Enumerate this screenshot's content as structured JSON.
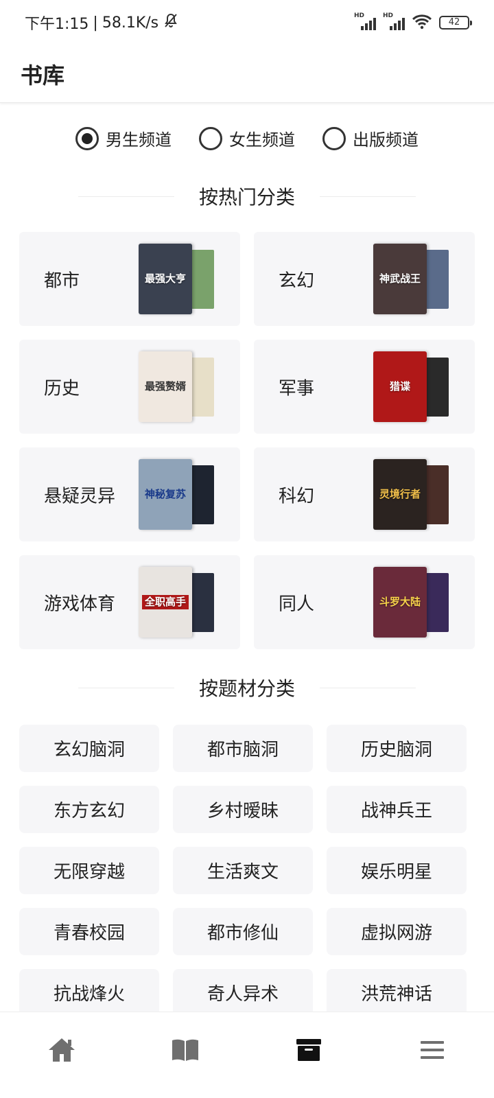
{
  "status_bar": {
    "time": "下午1:15",
    "speed": "58.1K/s",
    "signal_tag": "HD",
    "battery": "42",
    "icons": [
      "mute-bell-icon",
      "signal-icon",
      "wifi-icon",
      "battery-icon"
    ]
  },
  "header": {
    "title": "书库"
  },
  "channels": [
    {
      "label": "男生频道",
      "checked": true
    },
    {
      "label": "女生频道",
      "checked": false
    },
    {
      "label": "出版频道",
      "checked": false
    }
  ],
  "hot_section": {
    "title": "按热门分类",
    "cards": [
      {
        "label": "都市",
        "cover_title": "最强大亨",
        "front_color": "#3a4150",
        "back_color": "#7aa26b"
      },
      {
        "label": "玄幻",
        "cover_title": "神武战王",
        "front_color": "#4a3a3a",
        "back_color": "#5a6b8a"
      },
      {
        "label": "历史",
        "cover_title": "最强赘婿",
        "front_color": "#f0e8e0",
        "back_color": "#e7dfc8"
      },
      {
        "label": "军事",
        "cover_title": "猎谍",
        "front_color": "#b01818",
        "back_color": "#2a2a2a"
      },
      {
        "label": "悬疑灵异",
        "cover_title": "神秘复苏",
        "front_color": "#8fa3b8",
        "back_color": "#1e2430"
      },
      {
        "label": "科幻",
        "cover_title": "灵境行者",
        "front_color": "#2b2320",
        "back_color": "#4a2e28"
      },
      {
        "label": "游戏体育",
        "cover_title": "全职高手",
        "front_color": "#e8e4e0",
        "back_color": "#2a3040"
      },
      {
        "label": "同人",
        "cover_title": "斗罗大陆",
        "front_color": "#6a2a3a",
        "back_color": "#3a2a5a"
      }
    ]
  },
  "subject_section": {
    "title": "按题材分类",
    "chips": [
      "玄幻脑洞",
      "都市脑洞",
      "历史脑洞",
      "东方玄幻",
      "乡村暧昧",
      "战神兵王",
      "无限穿越",
      "生活爽文",
      "娱乐明星",
      "青春校园",
      "都市修仙",
      "虚拟网游",
      "抗战烽火",
      "奇人异术",
      "洪荒神话"
    ]
  },
  "bottom_nav": [
    {
      "icon": "home-icon",
      "active": false
    },
    {
      "icon": "book-open-icon",
      "active": false
    },
    {
      "icon": "archive-box-icon",
      "active": true
    },
    {
      "icon": "menu-icon",
      "active": false
    }
  ],
  "colors": {
    "text": "#222222",
    "card_bg": "#f6f6f8",
    "nav_inactive": "#6f6f6f",
    "nav_active": "#111111"
  }
}
